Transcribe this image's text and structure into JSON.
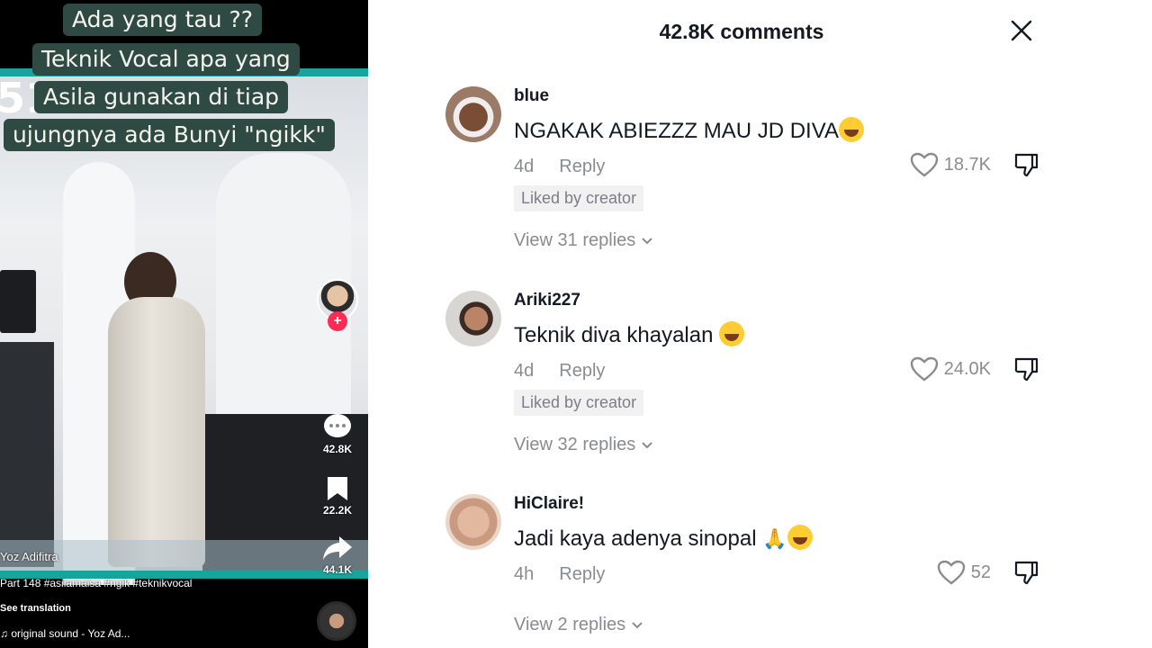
{
  "video": {
    "captions": [
      "Ada yang tau ??",
      "Teknik Vocal apa yang",
      "Asila gunakan di tiap",
      "ujungnya ada Bunyi \"ngikk\""
    ],
    "side_number": "51",
    "actions": {
      "comments": "42.8K",
      "saves": "22.2K",
      "shares": "44.1K"
    },
    "creator_name": "Yoz Adifitra",
    "description": "Part 148  #asilamaisa #ngik #teknikvocal",
    "see_translation": "See translation",
    "sound": "original sound - Yoz Ad..."
  },
  "panel": {
    "title": "42.8K comments",
    "comments": [
      {
        "user": "blue",
        "text": "NGAKAK ABIEZZZ MAU JD DIVA",
        "time": "4d",
        "reply_label": "Reply",
        "likes": "18.7K",
        "liked_by_creator": "Liked by creator",
        "view_replies": "View 31 replies"
      },
      {
        "user": "Ariki227",
        "text": "Teknik diva khayalan ",
        "time": "4d",
        "reply_label": "Reply",
        "likes": "24.0K",
        "liked_by_creator": "Liked by creator",
        "view_replies": "View 32 replies"
      },
      {
        "user": "HiClaire!",
        "text": "Jadi kaya adenya sinopal ",
        "time": "4h",
        "reply_label": "Reply",
        "likes": "52",
        "view_replies": "View 2 replies"
      }
    ]
  },
  "colors": {
    "accent": "#fe2c55",
    "caption_bg": "#2f4a43",
    "teal": "#16a59e",
    "muted": "#8a8b91"
  }
}
